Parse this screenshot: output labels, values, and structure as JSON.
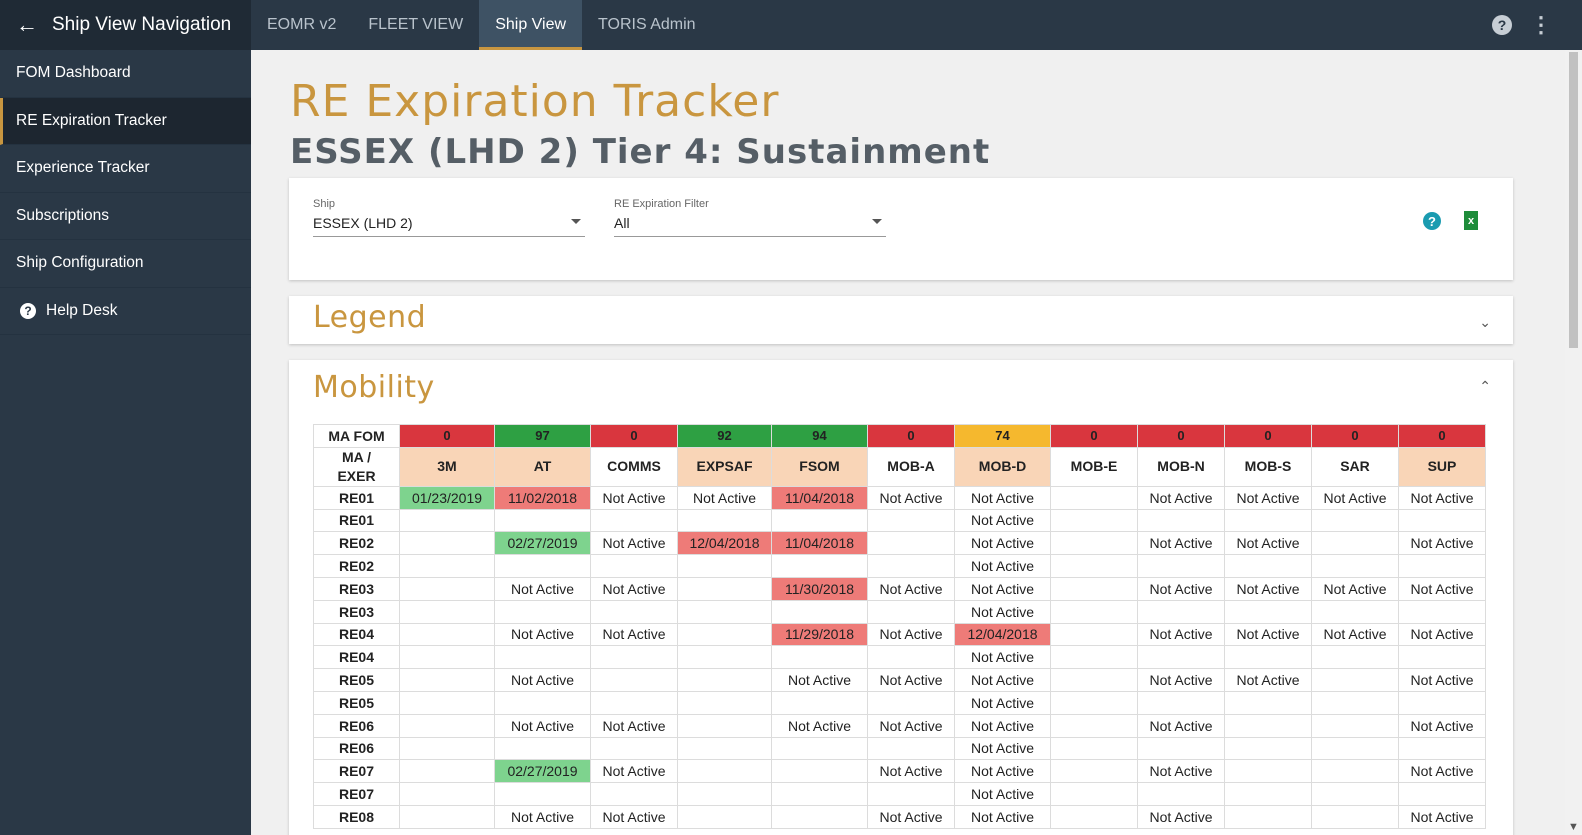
{
  "sidebar": {
    "title": "Ship View Navigation",
    "items": [
      {
        "label": "FOM Dashboard"
      },
      {
        "label": "RE Expiration Tracker"
      },
      {
        "label": "Experience Tracker"
      },
      {
        "label": "Subscriptions"
      },
      {
        "label": "Ship Configuration"
      },
      {
        "label": "Help Desk"
      }
    ],
    "active_index": 1
  },
  "topbar": {
    "tabs": [
      {
        "label": "EOMR v2"
      },
      {
        "label": "FLEET VIEW"
      },
      {
        "label": "Ship View"
      },
      {
        "label": "TORIS Admin"
      }
    ],
    "active_index": 2
  },
  "page": {
    "title": "RE Expiration Tracker",
    "subtitle": "ESSEX (LHD 2) Tier 4: Sustainment"
  },
  "filters": {
    "ship_label": "Ship",
    "ship_value": "ESSEX (LHD 2)",
    "re_filter_label": "RE Expiration Filter",
    "re_filter_value": "All"
  },
  "legend": {
    "title": "Legend"
  },
  "mobility": {
    "title": "Mobility",
    "fom_label": "MA FOM",
    "head_label_1": "MA /",
    "head_label_2": "EXER",
    "columns": [
      {
        "name": "3M",
        "score": "0",
        "score_color": "red",
        "peach": true
      },
      {
        "name": "AT",
        "score": "97",
        "score_color": "green",
        "peach": true
      },
      {
        "name": "COMMS",
        "score": "0",
        "score_color": "red",
        "peach": false
      },
      {
        "name": "EXPSAF",
        "score": "92",
        "score_color": "green",
        "peach": true
      },
      {
        "name": "FSOM",
        "score": "94",
        "score_color": "green",
        "peach": true
      },
      {
        "name": "MOB-A",
        "score": "0",
        "score_color": "red",
        "peach": false
      },
      {
        "name": "MOB-D",
        "score": "74",
        "score_color": "orange",
        "peach": true
      },
      {
        "name": "MOB-E",
        "score": "0",
        "score_color": "red",
        "peach": false
      },
      {
        "name": "MOB-N",
        "score": "0",
        "score_color": "red",
        "peach": false
      },
      {
        "name": "MOB-S",
        "score": "0",
        "score_color": "red",
        "peach": false
      },
      {
        "name": "SAR",
        "score": "0",
        "score_color": "red",
        "peach": false
      },
      {
        "name": "SUP",
        "score": "0",
        "score_color": "red",
        "peach": true
      }
    ],
    "rows": [
      {
        "label": "RE01",
        "cells": [
          {
            "t": "01/23/2019",
            "c": "green"
          },
          {
            "t": "11/02/2018",
            "c": "red"
          },
          {
            "t": "Not Active"
          },
          {
            "t": "Not Active"
          },
          {
            "t": "11/04/2018",
            "c": "red"
          },
          {
            "t": "Not Active"
          },
          {
            "t": "Not Active"
          },
          {
            "t": ""
          },
          {
            "t": "Not Active"
          },
          {
            "t": "Not Active"
          },
          {
            "t": "Not Active"
          },
          {
            "t": "Not Active"
          }
        ]
      },
      {
        "label": "RE01",
        "cells": [
          {
            "t": ""
          },
          {
            "t": ""
          },
          {
            "t": ""
          },
          {
            "t": ""
          },
          {
            "t": ""
          },
          {
            "t": ""
          },
          {
            "t": "Not Active"
          },
          {
            "t": ""
          },
          {
            "t": ""
          },
          {
            "t": ""
          },
          {
            "t": ""
          },
          {
            "t": ""
          }
        ]
      },
      {
        "label": "RE02",
        "cells": [
          {
            "t": ""
          },
          {
            "t": "02/27/2019",
            "c": "green"
          },
          {
            "t": "Not Active"
          },
          {
            "t": "12/04/2018",
            "c": "red"
          },
          {
            "t": "11/04/2018",
            "c": "red"
          },
          {
            "t": ""
          },
          {
            "t": "Not Active"
          },
          {
            "t": ""
          },
          {
            "t": "Not Active"
          },
          {
            "t": "Not Active"
          },
          {
            "t": ""
          },
          {
            "t": "Not Active"
          }
        ]
      },
      {
        "label": "RE02",
        "cells": [
          {
            "t": ""
          },
          {
            "t": ""
          },
          {
            "t": ""
          },
          {
            "t": ""
          },
          {
            "t": ""
          },
          {
            "t": ""
          },
          {
            "t": "Not Active"
          },
          {
            "t": ""
          },
          {
            "t": ""
          },
          {
            "t": ""
          },
          {
            "t": ""
          },
          {
            "t": ""
          }
        ]
      },
      {
        "label": "RE03",
        "cells": [
          {
            "t": ""
          },
          {
            "t": "Not Active"
          },
          {
            "t": "Not Active"
          },
          {
            "t": ""
          },
          {
            "t": "11/30/2018",
            "c": "red"
          },
          {
            "t": "Not Active"
          },
          {
            "t": "Not Active"
          },
          {
            "t": ""
          },
          {
            "t": "Not Active"
          },
          {
            "t": "Not Active"
          },
          {
            "t": "Not Active"
          },
          {
            "t": "Not Active"
          }
        ]
      },
      {
        "label": "RE03",
        "cells": [
          {
            "t": ""
          },
          {
            "t": ""
          },
          {
            "t": ""
          },
          {
            "t": ""
          },
          {
            "t": ""
          },
          {
            "t": ""
          },
          {
            "t": "Not Active"
          },
          {
            "t": ""
          },
          {
            "t": ""
          },
          {
            "t": ""
          },
          {
            "t": ""
          },
          {
            "t": ""
          }
        ]
      },
      {
        "label": "RE04",
        "cells": [
          {
            "t": ""
          },
          {
            "t": "Not Active"
          },
          {
            "t": "Not Active"
          },
          {
            "t": ""
          },
          {
            "t": "11/29/2018",
            "c": "red"
          },
          {
            "t": "Not Active"
          },
          {
            "t": "12/04/2018",
            "c": "red"
          },
          {
            "t": ""
          },
          {
            "t": "Not Active"
          },
          {
            "t": "Not Active"
          },
          {
            "t": "Not Active"
          },
          {
            "t": "Not Active"
          }
        ]
      },
      {
        "label": "RE04",
        "cells": [
          {
            "t": ""
          },
          {
            "t": ""
          },
          {
            "t": ""
          },
          {
            "t": ""
          },
          {
            "t": ""
          },
          {
            "t": ""
          },
          {
            "t": "Not Active"
          },
          {
            "t": ""
          },
          {
            "t": ""
          },
          {
            "t": ""
          },
          {
            "t": ""
          },
          {
            "t": ""
          }
        ]
      },
      {
        "label": "RE05",
        "cells": [
          {
            "t": ""
          },
          {
            "t": "Not Active"
          },
          {
            "t": ""
          },
          {
            "t": ""
          },
          {
            "t": "Not Active"
          },
          {
            "t": "Not Active"
          },
          {
            "t": "Not Active"
          },
          {
            "t": ""
          },
          {
            "t": "Not Active"
          },
          {
            "t": "Not Active"
          },
          {
            "t": ""
          },
          {
            "t": "Not Active"
          }
        ]
      },
      {
        "label": "RE05",
        "cells": [
          {
            "t": ""
          },
          {
            "t": ""
          },
          {
            "t": ""
          },
          {
            "t": ""
          },
          {
            "t": ""
          },
          {
            "t": ""
          },
          {
            "t": "Not Active"
          },
          {
            "t": ""
          },
          {
            "t": ""
          },
          {
            "t": ""
          },
          {
            "t": ""
          },
          {
            "t": ""
          }
        ]
      },
      {
        "label": "RE06",
        "cells": [
          {
            "t": ""
          },
          {
            "t": "Not Active"
          },
          {
            "t": "Not Active"
          },
          {
            "t": ""
          },
          {
            "t": "Not Active"
          },
          {
            "t": "Not Active"
          },
          {
            "t": "Not Active"
          },
          {
            "t": ""
          },
          {
            "t": "Not Active"
          },
          {
            "t": ""
          },
          {
            "t": ""
          },
          {
            "t": "Not Active"
          }
        ]
      },
      {
        "label": "RE06",
        "cells": [
          {
            "t": ""
          },
          {
            "t": ""
          },
          {
            "t": ""
          },
          {
            "t": ""
          },
          {
            "t": ""
          },
          {
            "t": ""
          },
          {
            "t": "Not Active"
          },
          {
            "t": ""
          },
          {
            "t": ""
          },
          {
            "t": ""
          },
          {
            "t": ""
          },
          {
            "t": ""
          }
        ]
      },
      {
        "label": "RE07",
        "cells": [
          {
            "t": ""
          },
          {
            "t": "02/27/2019",
            "c": "green"
          },
          {
            "t": "Not Active"
          },
          {
            "t": ""
          },
          {
            "t": ""
          },
          {
            "t": "Not Active"
          },
          {
            "t": "Not Active"
          },
          {
            "t": ""
          },
          {
            "t": "Not Active"
          },
          {
            "t": ""
          },
          {
            "t": ""
          },
          {
            "t": "Not Active"
          }
        ]
      },
      {
        "label": "RE07",
        "cells": [
          {
            "t": ""
          },
          {
            "t": ""
          },
          {
            "t": ""
          },
          {
            "t": ""
          },
          {
            "t": ""
          },
          {
            "t": ""
          },
          {
            "t": "Not Active"
          },
          {
            "t": ""
          },
          {
            "t": ""
          },
          {
            "t": ""
          },
          {
            "t": ""
          },
          {
            "t": ""
          }
        ]
      },
      {
        "label": "RE08",
        "cells": [
          {
            "t": ""
          },
          {
            "t": "Not Active"
          },
          {
            "t": "Not Active"
          },
          {
            "t": ""
          },
          {
            "t": ""
          },
          {
            "t": "Not Active"
          },
          {
            "t": "Not Active"
          },
          {
            "t": ""
          },
          {
            "t": "Not Active"
          },
          {
            "t": ""
          },
          {
            "t": ""
          },
          {
            "t": "Not Active"
          }
        ]
      }
    ]
  },
  "colors": {
    "accent": "#c9963f",
    "nav_bg": "#2a3846",
    "score_green": "#2ea043",
    "score_red": "#d9363e",
    "score_orange": "#f5b82e",
    "cell_green": "#7ed38e",
    "cell_red": "#ee7b78",
    "header_peach": "#f9d5b7"
  },
  "icons": [
    "back-arrow-icon",
    "help-icon",
    "more-vert-icon",
    "excel-icon",
    "chevron-down-icon",
    "chevron-up-icon",
    "dropdown-caret-icon"
  ]
}
